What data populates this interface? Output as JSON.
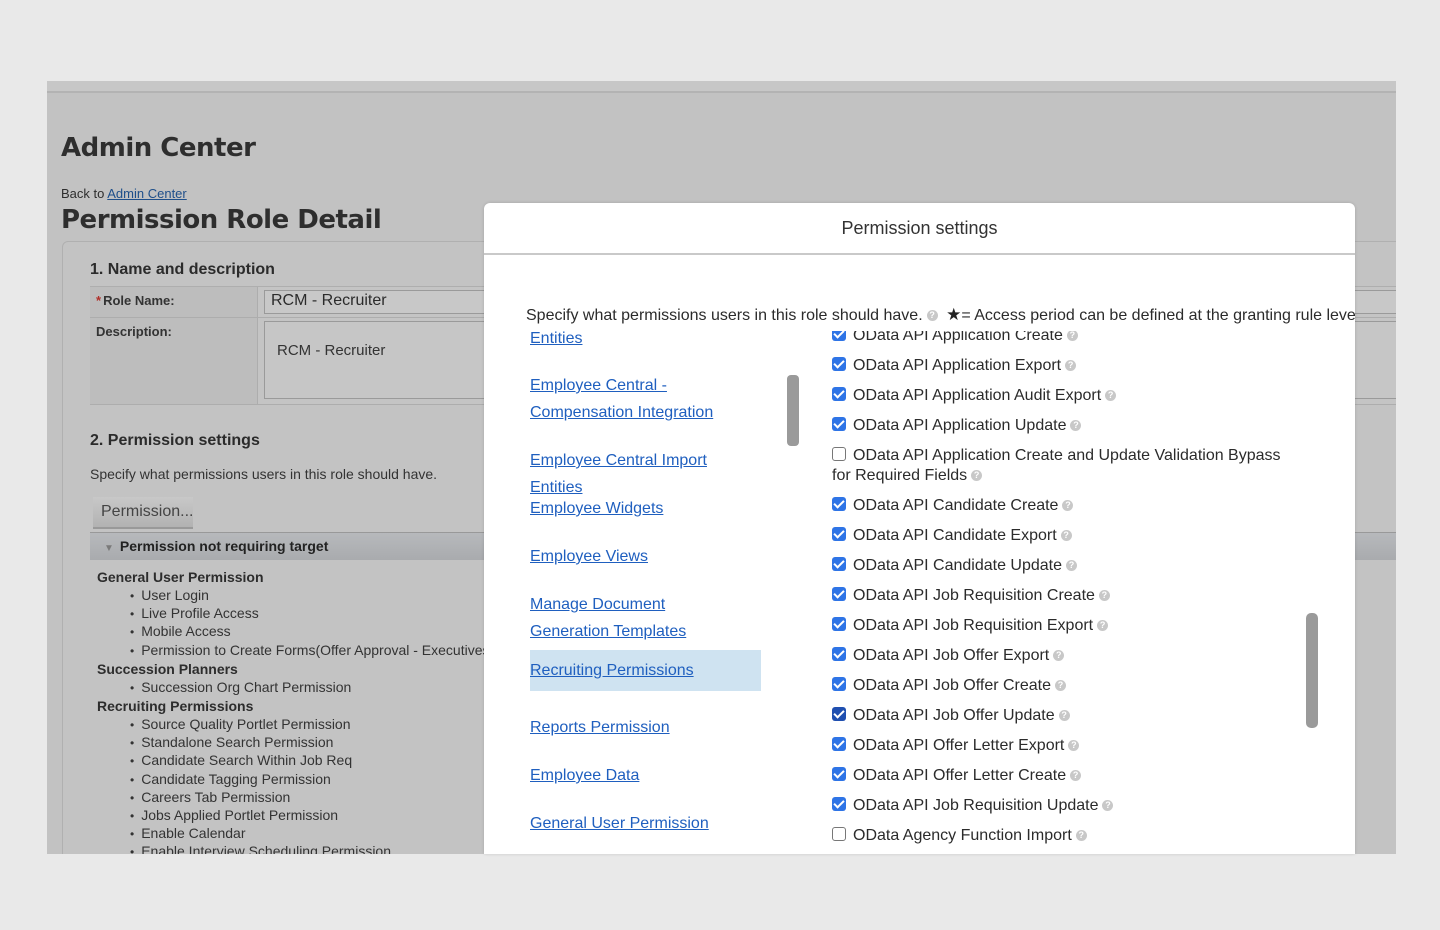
{
  "page": {
    "title": "Admin Center",
    "back_prefix": "Back to",
    "back_link": "Admin Center",
    "subtitle": "Permission Role Detail",
    "section1": {
      "title": "1. Name and description",
      "role_name_label": "Role Name:",
      "required_mark": "*",
      "role_name_value": "RCM - Recruiter",
      "description_label": "Description:",
      "description_value": "RCM - Recruiter"
    },
    "section2": {
      "title": "2. Permission settings",
      "description": "Specify what permissions users in this role should have.",
      "button_label": "Permission...",
      "group_bar_label": "Permission not requiring target",
      "groups": [
        {
          "name": "General User Permission",
          "items": [
            "User Login",
            "Live Profile Access",
            "Mobile Access",
            "Permission to Create Forms(Offer Approval - Executives, Offe"
          ]
        },
        {
          "name": "Succession Planners",
          "items": [
            "Succession Org Chart Permission"
          ]
        },
        {
          "name": "Recruiting Permissions",
          "items": [
            "Source Quality Portlet Permission",
            "Standalone Search Permission",
            "Candidate Search Within Job Req",
            "Candidate Tagging Permission",
            "Careers Tab Permission",
            "Jobs Applied Portlet Permission",
            "Enable Calendar",
            "Enable Interview Scheduling Permission"
          ]
        }
      ]
    }
  },
  "modal": {
    "title": "Permission settings",
    "description": "Specify what permissions users in this role should have.",
    "star_note": "= Access period can be defined at the granting rule level.",
    "categories": [
      {
        "label": "Entities",
        "selected": false,
        "clipped": true
      },
      {
        "label": "Employee Central - Compensation Integration",
        "selected": false
      },
      {
        "label": "Employee Central Import Entities",
        "selected": false
      },
      {
        "label": "Employee Widgets",
        "selected": false
      },
      {
        "label": "Employee Views",
        "selected": false
      },
      {
        "label": "Manage Document Generation Templates",
        "selected": false
      },
      {
        "label": "Recruiting Permissions",
        "selected": true
      },
      {
        "label": "Reports Permission",
        "selected": false
      },
      {
        "label": "Employee Data",
        "selected": false
      },
      {
        "label": "General User Permission",
        "selected": false
      }
    ],
    "options": [
      {
        "label": "OData API Application Create",
        "checked": true,
        "clipped": true
      },
      {
        "label": "OData API Application Export",
        "checked": true
      },
      {
        "label": "OData API Application Audit Export",
        "checked": true
      },
      {
        "label": "OData API Application Update",
        "checked": true
      },
      {
        "label": "OData API Application Create and Update Validation Bypass for Required Fields",
        "checked": false
      },
      {
        "label": "OData API Candidate Create",
        "checked": true
      },
      {
        "label": "OData API Candidate Export",
        "checked": true
      },
      {
        "label": "OData API Candidate Update",
        "checked": true
      },
      {
        "label": "OData API Job Requisition Create",
        "checked": true
      },
      {
        "label": "OData API Job Requisition Export",
        "checked": true
      },
      {
        "label": "OData API Job Offer Export",
        "checked": true
      },
      {
        "label": "OData API Job Offer Create",
        "checked": true
      },
      {
        "label": "OData API Job Offer Update",
        "checked": true
      },
      {
        "label": "OData API Offer Letter Export",
        "checked": true
      },
      {
        "label": "OData API Offer Letter Create",
        "checked": true
      },
      {
        "label": "OData API Job Requisition Update",
        "checked": true
      },
      {
        "label": "OData Agency Function Import",
        "checked": false,
        "clipped": true
      }
    ]
  },
  "icons": {
    "help": "?",
    "star": "★",
    "collapse_triangle": "▼"
  },
  "colors": {
    "link": "#1f5fbf",
    "checkbox_checked": "#2e74e6",
    "selected_category_bg": "#cfe3f1",
    "overlay_gray": "#c2c2c2"
  }
}
